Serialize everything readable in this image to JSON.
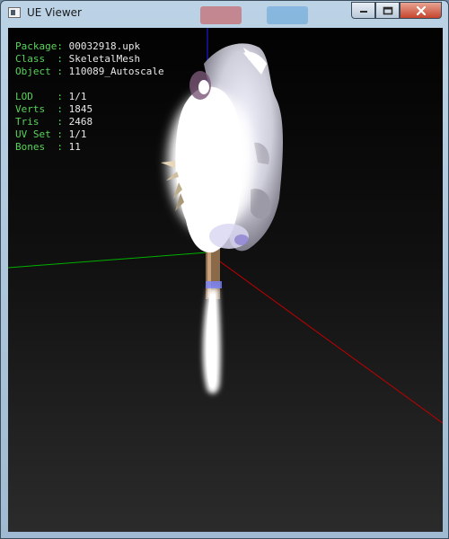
{
  "window": {
    "title": "UE Viewer",
    "icons": {
      "app": "app-icon",
      "minimize": "minimize-icon",
      "maximize": "maximize-icon",
      "close": "close-icon"
    }
  },
  "info": {
    "package": {
      "label": "Package:",
      "value": "00032918.upk"
    },
    "class": {
      "label": "Class  :",
      "value": "SkeletalMesh"
    },
    "object": {
      "label": "Object :",
      "value": "110089_Autoscale"
    },
    "lod": {
      "label": "LOD    :",
      "value": "1/1"
    },
    "verts": {
      "label": "Verts  :",
      "value": "1845"
    },
    "tris": {
      "label": "Tris   :",
      "value": "2468"
    },
    "uvset": {
      "label": "UV Set :",
      "value": "1/1"
    },
    "bones": {
      "label": "Bones  :",
      "value": "11"
    }
  },
  "colors": {
    "label": "#59d35a",
    "value": "#e8e8e8",
    "axis_x": "#c00000",
    "axis_y": "#00b000",
    "axis_z": "#1c1cff"
  }
}
